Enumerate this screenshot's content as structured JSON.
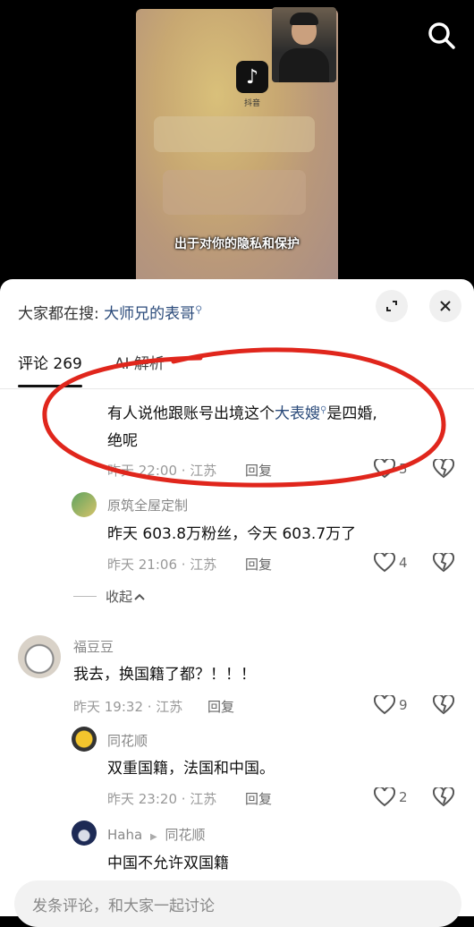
{
  "video": {
    "subtitle": "出于对你的隐私和保护",
    "app_logo_label": "抖音"
  },
  "header": {
    "search_prefix": "大家都在搜:",
    "search_term": "大师兄的表哥"
  },
  "tabs": [
    {
      "label": "评论 269"
    },
    {
      "label": "AI 解析"
    }
  ],
  "comments": [
    {
      "text_before": "有人说他跟账号出境这个",
      "highlight": "大表嫂",
      "text_after": "是四婚,",
      "text_line2": "绝呢",
      "time": "昨天 22:00 · 江苏",
      "reply": "回复",
      "likes": "5"
    },
    {
      "name": "原筑全屋定制",
      "text": "昨天 603.8万粉丝，今天 603.7万了",
      "time": "昨天 21:06 · 江苏",
      "reply": "回复",
      "likes": "4"
    },
    {
      "name": "福豆豆",
      "text": "我去，换国籍了都？！！！",
      "time": "昨天 19:32 · 江苏",
      "reply": "回复",
      "likes": "9"
    },
    {
      "name": "同花顺",
      "text": "双重国籍，法国和中国。",
      "time": "昨天 23:20 · 江苏",
      "reply": "回复",
      "likes": "2"
    },
    {
      "name": "Haha",
      "reply_to": "同花顺",
      "text": "中国不允许双国籍"
    }
  ],
  "collapse_label": "收起",
  "input": {
    "placeholder": "发条评论，和大家一起讨论"
  },
  "colors": {
    "annotation": "#e0261c",
    "link": "#2a4a7a"
  },
  "icons": [
    "search-icon",
    "expand-icon",
    "close-icon",
    "heart-icon",
    "broken-heart-icon",
    "search-query-icon"
  ]
}
